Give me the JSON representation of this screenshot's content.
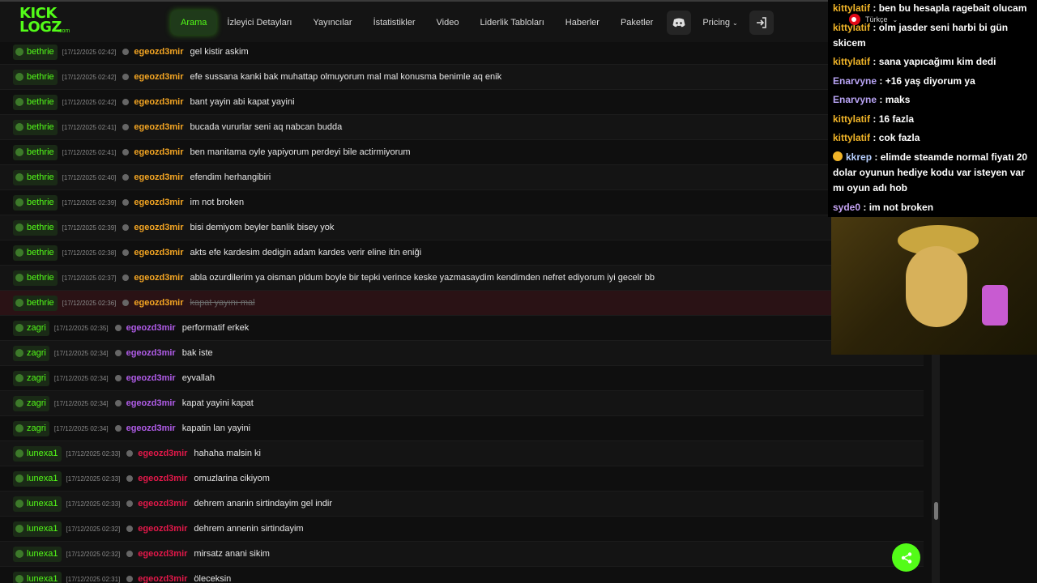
{
  "logo": {
    "line1": "KICK",
    "line2": "LOGZ",
    "suffix": ".com"
  },
  "nav": {
    "items": [
      "Arama",
      "İzleyici Detayları",
      "Yayıncılar",
      "İstatistikler",
      "Video",
      "Liderlik Tabloları",
      "Haberler",
      "Paketler"
    ],
    "pricing": "Pricing",
    "language": "Türkçe"
  },
  "colors": {
    "accent": "#53fc18",
    "orange_user": "#f5a623",
    "purple_user": "#b05ce8",
    "red_user": "#e4184a"
  },
  "rows": [
    {
      "channel": "bethrie",
      "time": "[17/12/2025 02:42]",
      "user": "egeozd3mir",
      "msg": "gel kistir askim"
    },
    {
      "channel": "bethrie",
      "time": "[17/12/2025 02:42]",
      "user": "egeozd3mir",
      "msg": "efe sussana kanki bak muhattap olmuyorum mal mal konusma benimle aq enik"
    },
    {
      "channel": "bethrie",
      "time": "[17/12/2025 02:42]",
      "user": "egeozd3mir",
      "msg": "bant yayin abi kapat yayini"
    },
    {
      "channel": "bethrie",
      "time": "[17/12/2025 02:41]",
      "user": "egeozd3mir",
      "msg": "bucada vururlar seni aq nabcan budda"
    },
    {
      "channel": "bethrie",
      "time": "[17/12/2025 02:41]",
      "user": "egeozd3mir",
      "msg": "ben manitama oyle yapiyorum perdeyi bile actirmiyorum"
    },
    {
      "channel": "bethrie",
      "time": "[17/12/2025 02:40]",
      "user": "egeozd3mir",
      "msg": "efendim herhangibiri"
    },
    {
      "channel": "bethrie",
      "time": "[17/12/2025 02:39]",
      "user": "egeozd3mir",
      "msg": "im not broken"
    },
    {
      "channel": "bethrie",
      "time": "[17/12/2025 02:39]",
      "user": "egeozd3mir",
      "msg": "bisi demiyom beyler banlik bisey yok"
    },
    {
      "channel": "bethrie",
      "time": "[17/12/2025 02:38]",
      "user": "egeozd3mir",
      "msg": "akts efe kardesim dedigin adam kardes verir eline itin eniği"
    },
    {
      "channel": "bethrie",
      "time": "[17/12/2025 02:37]",
      "user": "egeozd3mir",
      "msg": "abla ozurdilerim ya oisman pldum boyle bir tepki verince keske yazmasaydim kendimden nefret ediyorum iyi gecelr bb"
    },
    {
      "channel": "bethrie",
      "time": "[17/12/2025 02:36]",
      "user": "egeozd3mir",
      "msg": "kapat yayını mal"
    },
    {
      "channel": "zagri",
      "time": "[17/12/2025 02:35]",
      "user": "egeozd3mir",
      "msg": "performatif erkek"
    },
    {
      "channel": "zagri",
      "time": "[17/12/2025 02:34]",
      "user": "egeozd3mir",
      "msg": "bak iste"
    },
    {
      "channel": "zagri",
      "time": "[17/12/2025 02:34]",
      "user": "egeozd3mir",
      "msg": "eyvallah"
    },
    {
      "channel": "zagri",
      "time": "[17/12/2025 02:34]",
      "user": "egeozd3mir",
      "msg": "kapat yayini kapat"
    },
    {
      "channel": "zagri",
      "time": "[17/12/2025 02:34]",
      "user": "egeozd3mir",
      "msg": "kapatin lan yayini"
    },
    {
      "channel": "lunexa1",
      "time": "[17/12/2025 02:33]",
      "user": "egeozd3mir",
      "msg": "hahaha malsin ki"
    },
    {
      "channel": "lunexa1",
      "time": "[17/12/2025 02:33]",
      "user": "egeozd3mir",
      "msg": "omuzlarina cikiyom"
    },
    {
      "channel": "lunexa1",
      "time": "[17/12/2025 02:33]",
      "user": "egeozd3mir",
      "msg": "dehrem ananin sirtindayim gel indir"
    },
    {
      "channel": "lunexa1",
      "time": "[17/12/2025 02:32]",
      "user": "egeozd3mir",
      "msg": "dehrem annenin sirtindayim"
    },
    {
      "channel": "lunexa1",
      "time": "[17/12/2025 02:32]",
      "user": "egeozd3mir",
      "msg": "mirsatz anani sikim"
    },
    {
      "channel": "lunexa1",
      "time": "[17/12/2025 02:31]",
      "user": "egeozd3mir",
      "msg": "öleceksin"
    }
  ],
  "overlay": [
    {
      "user": "kittylatif",
      "msg": "ben bu hesapla ragebait olucam"
    },
    {
      "user": "kittylatif",
      "msg": "olm jasder seni harbi bi gün skicem"
    },
    {
      "user": "kittylatif",
      "msg": "sana yapıcağımı kim dedi"
    },
    {
      "user": "Enarvyne",
      "msg": "+16 yaş diyorum ya"
    },
    {
      "user": "Enarvyne",
      "msg": "maks"
    },
    {
      "user": "kittylatif",
      "msg": "16 fazla"
    },
    {
      "user": "kittylatif",
      "msg": "cok fazla"
    },
    {
      "user": "kkrep",
      "msg": "elimde steamde normal fiyatı 20 dolar oyunun hediye kodu var isteyen var mı oyun adı hob"
    },
    {
      "user": "syde0",
      "msg": "im not broken"
    }
  ]
}
